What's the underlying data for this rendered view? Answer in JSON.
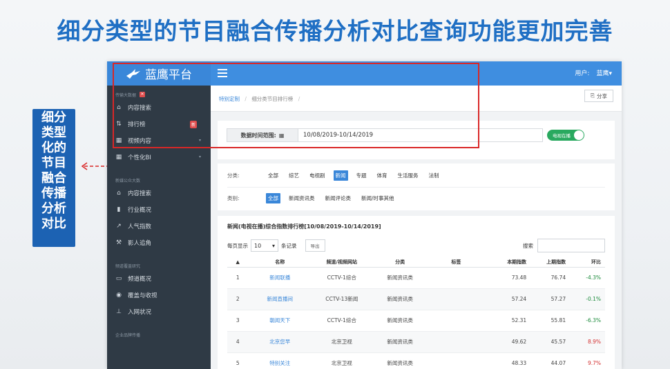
{
  "slide": {
    "title": "细分类型的节目融合传播分析对比查询功能更加完善",
    "side_label_lines": [
      "细分",
      "类型",
      "化的",
      "节目",
      "融合",
      "传播",
      "分析",
      "对比"
    ]
  },
  "app": {
    "brand": "蓝鹰平台",
    "user_label": "用户:",
    "user_name": "蓝鹰▾"
  },
  "sidebar": {
    "sections": [
      {
        "title": "传输大数据",
        "items": [
          {
            "label": "内容搜索",
            "icon": "home-icon",
            "badge": ""
          },
          {
            "label": "排行榜",
            "icon": "sort-icon",
            "badge": "新"
          },
          {
            "label": "视频内容",
            "icon": "grid-icon",
            "badge": ""
          },
          {
            "label": "个性化BI",
            "icon": "grid-icon",
            "badge": ""
          }
        ]
      },
      {
        "title": "新媒公众大数",
        "items": [
          {
            "label": "内容搜索",
            "icon": "home-icon"
          },
          {
            "label": "行业概况",
            "icon": "bar-chart-icon"
          },
          {
            "label": "人气指数",
            "icon": "line-chart-icon"
          },
          {
            "label": "影人追角",
            "icon": "gavel-icon"
          }
        ]
      },
      {
        "title": "频道覆盖研究",
        "items": [
          {
            "label": "频道概况",
            "icon": "monitor-icon"
          },
          {
            "label": "覆盖与收视",
            "icon": "globe-icon"
          },
          {
            "label": "入网状况",
            "icon": "pin-icon"
          }
        ]
      },
      {
        "title": "企业品牌传播",
        "items": []
      }
    ]
  },
  "breadcrumb": [
    "特别定制",
    "细分类节目排行榜"
  ],
  "share_label": "分享",
  "filter": {
    "date_label": "数据时间范围:",
    "date_value": "10/08/2019-10/14/2019",
    "toggle_label": "电视在播"
  },
  "categories": {
    "class_label": "分类:",
    "class_options": [
      "全部",
      "综艺",
      "电视剧",
      "新闻",
      "专题",
      "体育",
      "生活服务",
      "法制"
    ],
    "class_selected": 3,
    "type_label": "类别:",
    "type_options": [
      "全部",
      "新闻资讯类",
      "新闻评论类",
      "新闻/时事其他"
    ],
    "type_selected": 0
  },
  "ranking": {
    "title": "新闻(电视在播)综合指数排行榜[10/08/2019-10/14/2019]",
    "per_page_label": "每页显示",
    "per_page_value": "10",
    "records_label": "条记录",
    "export_label": "导出",
    "search_label": "搜索",
    "columns": [
      "",
      "名称",
      "频道/视频网站",
      "分类",
      "标签",
      "本期指数",
      "上期指数",
      "环比"
    ],
    "rows": [
      {
        "rank": "1",
        "name": "新闻联播",
        "channel": "CCTV-1综合",
        "category": "新闻资讯类",
        "tag": "",
        "current": "73.48",
        "previous": "76.74",
        "change": "-4.3%",
        "trend": "neg"
      },
      {
        "rank": "2",
        "name": "新闻直播间",
        "channel": "CCTV-13新闻",
        "category": "新闻资讯类",
        "tag": "",
        "current": "57.24",
        "previous": "57.27",
        "change": "-0.1%",
        "trend": "neg"
      },
      {
        "rank": "3",
        "name": "朝闻天下",
        "channel": "CCTV-1综合",
        "category": "新闻资讯类",
        "tag": "",
        "current": "52.31",
        "previous": "55.81",
        "change": "-6.3%",
        "trend": "neg"
      },
      {
        "rank": "4",
        "name": "北京您早",
        "channel": "北京卫视",
        "category": "新闻资讯类",
        "tag": "",
        "current": "49.62",
        "previous": "45.57",
        "change": "8.9%",
        "trend": "pos"
      },
      {
        "rank": "5",
        "name": "特别关注",
        "channel": "北京卫视",
        "category": "新闻资讯类",
        "tag": "",
        "current": "48.33",
        "previous": "44.07",
        "change": "9.7%",
        "trend": "pos"
      }
    ]
  },
  "colors": {
    "title_blue": "#1f6fc4",
    "topbar": "#3f8ee0",
    "sidebar": "#2f3a45",
    "highlight_red": "#d92727",
    "toggle_green": "#29a95f",
    "negative_green": "#1a8a3a",
    "positive_red": "#d32f2f"
  }
}
